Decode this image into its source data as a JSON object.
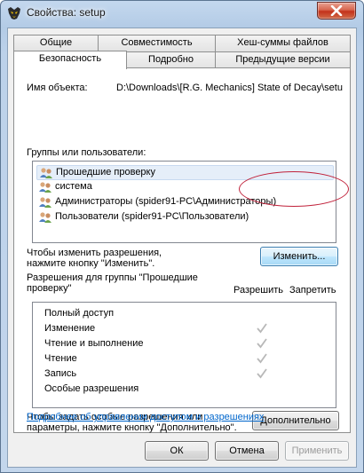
{
  "window": {
    "title": "Свойства: setup"
  },
  "tabs_row1": [
    "Общие",
    "Совместимость",
    "Хеш-суммы файлов"
  ],
  "tabs_row2": [
    "Безопасность",
    "Подробно",
    "Предыдущие версии"
  ],
  "object": {
    "label": "Имя объекта:",
    "value": "D:\\Downloads\\[R.G. Mechanics] State of Decay\\setu"
  },
  "groups": {
    "label": "Группы или пользователи:",
    "items": [
      "Прошедшие проверку",
      "система",
      "Администраторы (spider91-PC\\Администраторы)",
      "Пользователи (spider91-PC\\Пользователи)"
    ],
    "selected_index": 0
  },
  "change": {
    "hint_line1": "Чтобы изменить разрешения,",
    "hint_line2": "нажмите кнопку \"Изменить\".",
    "button_label": "Изменить..."
  },
  "permissions": {
    "header_line1": "Разрешения для группы \"Прошедшие",
    "header_line2": "проверку\"",
    "allow_label": "Разрешить",
    "deny_label": "Запретить",
    "rows": [
      {
        "name": "Полный доступ",
        "allow": false,
        "deny": false
      },
      {
        "name": "Изменение",
        "allow": true,
        "deny": false
      },
      {
        "name": "Чтение и выполнение",
        "allow": true,
        "deny": false
      },
      {
        "name": "Чтение",
        "allow": true,
        "deny": false
      },
      {
        "name": "Запись",
        "allow": true,
        "deny": false
      },
      {
        "name": "Особые разрешения",
        "allow": false,
        "deny": false
      }
    ]
  },
  "advanced": {
    "hint_line1": "Чтобы задать особые разрешения или",
    "hint_line2": "параметры, нажмите кнопку \"Дополнительно\".",
    "button_label": "Дополнительно"
  },
  "link": {
    "text": "Подробнее об управлении доступом и разрешениях"
  },
  "footer": {
    "ok_label": "ОК",
    "cancel_label": "Отмена",
    "apply_label": "Применить"
  },
  "colors": {
    "link": "#0066cc",
    "ring": "#c0223b",
    "check": "#b8b8b8"
  }
}
